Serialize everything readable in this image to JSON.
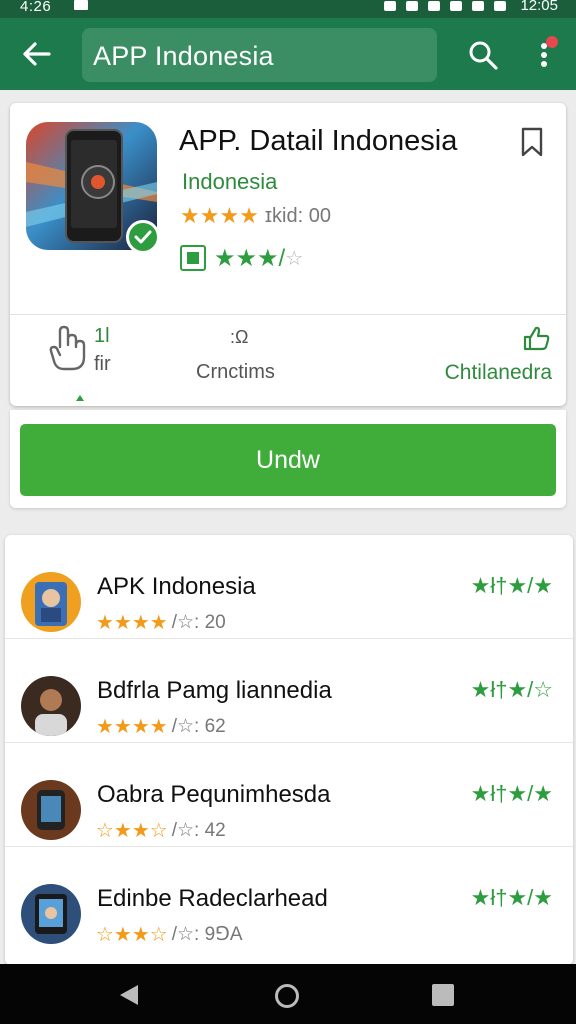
{
  "status_bar": {
    "time": "4:26",
    "clock": "12:05"
  },
  "app_bar": {
    "search_text": "APP Indonesia"
  },
  "detail": {
    "title": "APP. Datail Indonesia",
    "developer": "Indonesia",
    "stars": "★★★★",
    "rating_text": "ɪkid: 00",
    "green_stars": "★★★/",
    "green_half": "☆",
    "stat_value": "1l",
    "stat_label_left": "fir",
    "stat_icon_mid": ":Ω",
    "stat_label_mid": "Crnctims",
    "stat_label_right": "Chtilanedra"
  },
  "install": {
    "label": "Undw"
  },
  "list": [
    {
      "name": "APK Indonesia",
      "stars": "★★★★",
      "rating": "/☆: 20",
      "right_stars": "★ł†★/★",
      "avatar_color": "#3b6fb5"
    },
    {
      "name": "Bdfrla Pamg liannedia",
      "stars": "★★★★",
      "rating": "/☆: 62",
      "right_stars": "★ł†★/☆",
      "avatar_color": "#5a3d2b"
    },
    {
      "name": "Oabra Pequnimhesda",
      "stars": "☆★★☆",
      "rating": "/☆: 42",
      "right_stars": "★ł†★/★",
      "avatar_color": "#2b2b2b"
    },
    {
      "name": "Edinbe Radeclarhead",
      "stars": "☆★★☆",
      "rating": "/☆: 9⅁A",
      "right_stars": "★ł†★/★",
      "avatar_color": "#3a6fa8"
    }
  ],
  "colors": {
    "app_bar": "#1d7a4d",
    "accent_green": "#40ad3a",
    "star_orange": "#f29a1a"
  }
}
